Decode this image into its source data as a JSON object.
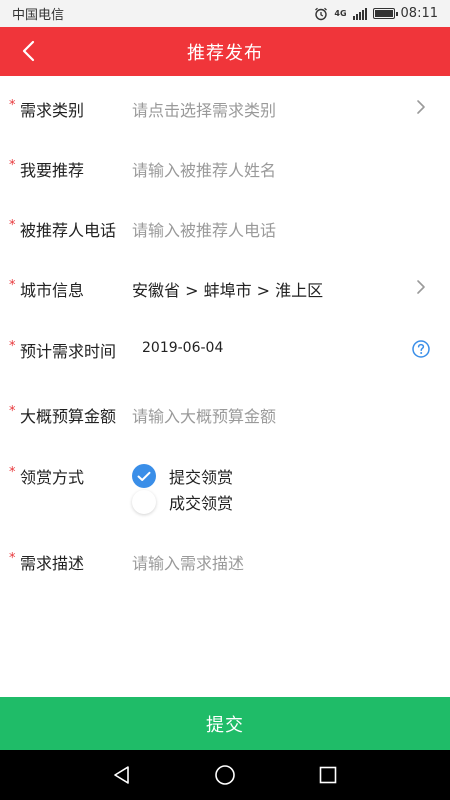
{
  "status_bar": {
    "carrier": "中国电信",
    "network": "4G",
    "time": "08:11"
  },
  "header": {
    "title": "推荐发布",
    "back_icon": "chevron-left-icon"
  },
  "form": {
    "category": {
      "label": "需求类别",
      "placeholder": "请点击选择需求类别"
    },
    "recommend": {
      "label": "我要推荐",
      "placeholder": "请输入被推荐人姓名"
    },
    "phone": {
      "label": "被推荐人电话",
      "placeholder": "请输入被推荐人电话"
    },
    "city": {
      "label": "城市信息",
      "value": "安徽省 > 蚌埠市 > 淮上区"
    },
    "expected_time": {
      "label": "预计需求时间",
      "value": "2019-06-04"
    },
    "budget": {
      "label": "大概预算金额",
      "placeholder": "请输入大概预算金额"
    },
    "reward": {
      "label": "领赏方式",
      "options": [
        {
          "label": "提交领赏",
          "selected": true
        },
        {
          "label": "成交领赏",
          "selected": false
        }
      ]
    },
    "description": {
      "label": "需求描述",
      "placeholder": "请输入需求描述"
    },
    "required_mark": "*"
  },
  "submit": {
    "label": "提交"
  },
  "colors": {
    "header": "#f0353a",
    "submit": "#1fbc68",
    "radio": "#3a8ee8",
    "required": "#e8363a"
  }
}
